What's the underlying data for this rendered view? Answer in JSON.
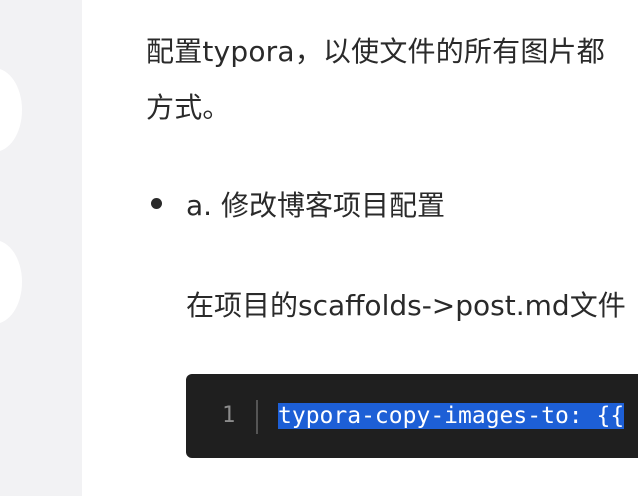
{
  "article": {
    "paragraph_line1": "配置typora，以使文件的所有图片都",
    "paragraph_line2": "方式。",
    "bullet_item": "a. 修改博客项目配置",
    "sub_paragraph": "在项目的scaffolds->post.md文件"
  },
  "code_block": {
    "line_number": "1",
    "code": "typora-copy-images-to: {{"
  },
  "colors": {
    "code_background": "#1f1f1f",
    "selection": "#1d5fd6",
    "sidebar_background": "#f2f2f4"
  }
}
